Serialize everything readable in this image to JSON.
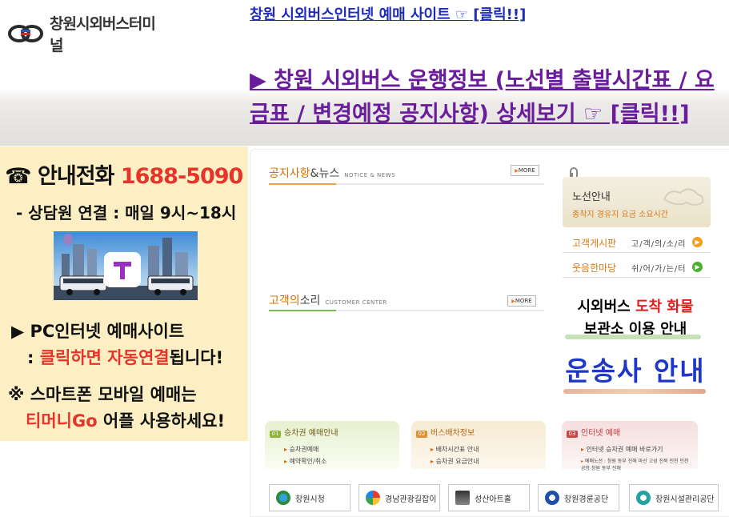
{
  "header": {
    "logo_text": "창원시외버스터미널",
    "link_ticket": "창원 시외버스인터넷 예매 사이트 ☞ [클릭!!]",
    "link_schedule": "▶ 창원 시외버스 운행정보 (노선별 출발시간표 / 요금표 / 변경예정 공지사항) 상세보기 ☞ [클릭!!]"
  },
  "left": {
    "phone_label": "☎ 안내전화",
    "phone_number": "1688-5090",
    "hours": "- 상담원 연결 : 매일 9시~18시",
    "pc_line1": "▶ PC인터넷 예매사이트",
    "pc_line2_prefix": ": ",
    "pc_line2_red": "클릭하면 자동연결",
    "pc_line2_suffix": "됩니다!",
    "smart_line1": "※ 스마트폰 모바일 예매는",
    "smart_line2_red": "티머니Go",
    "smart_line2_suffix": " 어플 사용하세요!"
  },
  "main": {
    "notice_title_acc": "공지사항",
    "notice_title_rest": "&뉴스",
    "notice_sub": "NOTICE & NEWS",
    "voice_title_acc": "고객의",
    "voice_title_rest": "소리",
    "voice_sub": "CUSTOMER CENTER",
    "more_label": "MORE"
  },
  "right": {
    "route_title": "노선안내",
    "route_sub": "종착지 경유지 요금 소요시간",
    "board1_label": "고객게시판",
    "board1_text": "고/객/의/소/리",
    "board2_label": "웃음한마당",
    "board2_text": "쉬/어/가/는/터",
    "cargo_line1_black": "시외버스 ",
    "cargo_line1_red": "도착 화물",
    "cargo_line2": "보관소 이용 안내",
    "carrier": "운송사 안내"
  },
  "boxes": [
    {
      "num": "01",
      "title": "승차권 예매안내",
      "items": [
        "승차권예매",
        "예약확인/취소"
      ]
    },
    {
      "num": "02",
      "title": "버스배차정보",
      "items": [
        "배차시간표 안내",
        "승차권 요금안내"
      ]
    },
    {
      "num": "03",
      "title": "인터넷 예매",
      "items": [
        "인터넷 승차권 예매 바로가기",
        "예매노선 : 창원 동부 진해 마산 고성 진북 인천 인천공항 창원 동부 진해"
      ]
    }
  ],
  "footer_links": [
    "창원시청",
    "경남관광길잡이",
    "성산아트홀",
    "창원경륜공단",
    "창원시설관리공단"
  ],
  "colors": {
    "accent_red": "#e6342a",
    "link_blue": "#1d2bb8",
    "link_purple": "#6a1d9b",
    "carrier_blue": "#1f37c8",
    "panel_yellow": "#fbefc3",
    "orange": "#d77a16"
  }
}
